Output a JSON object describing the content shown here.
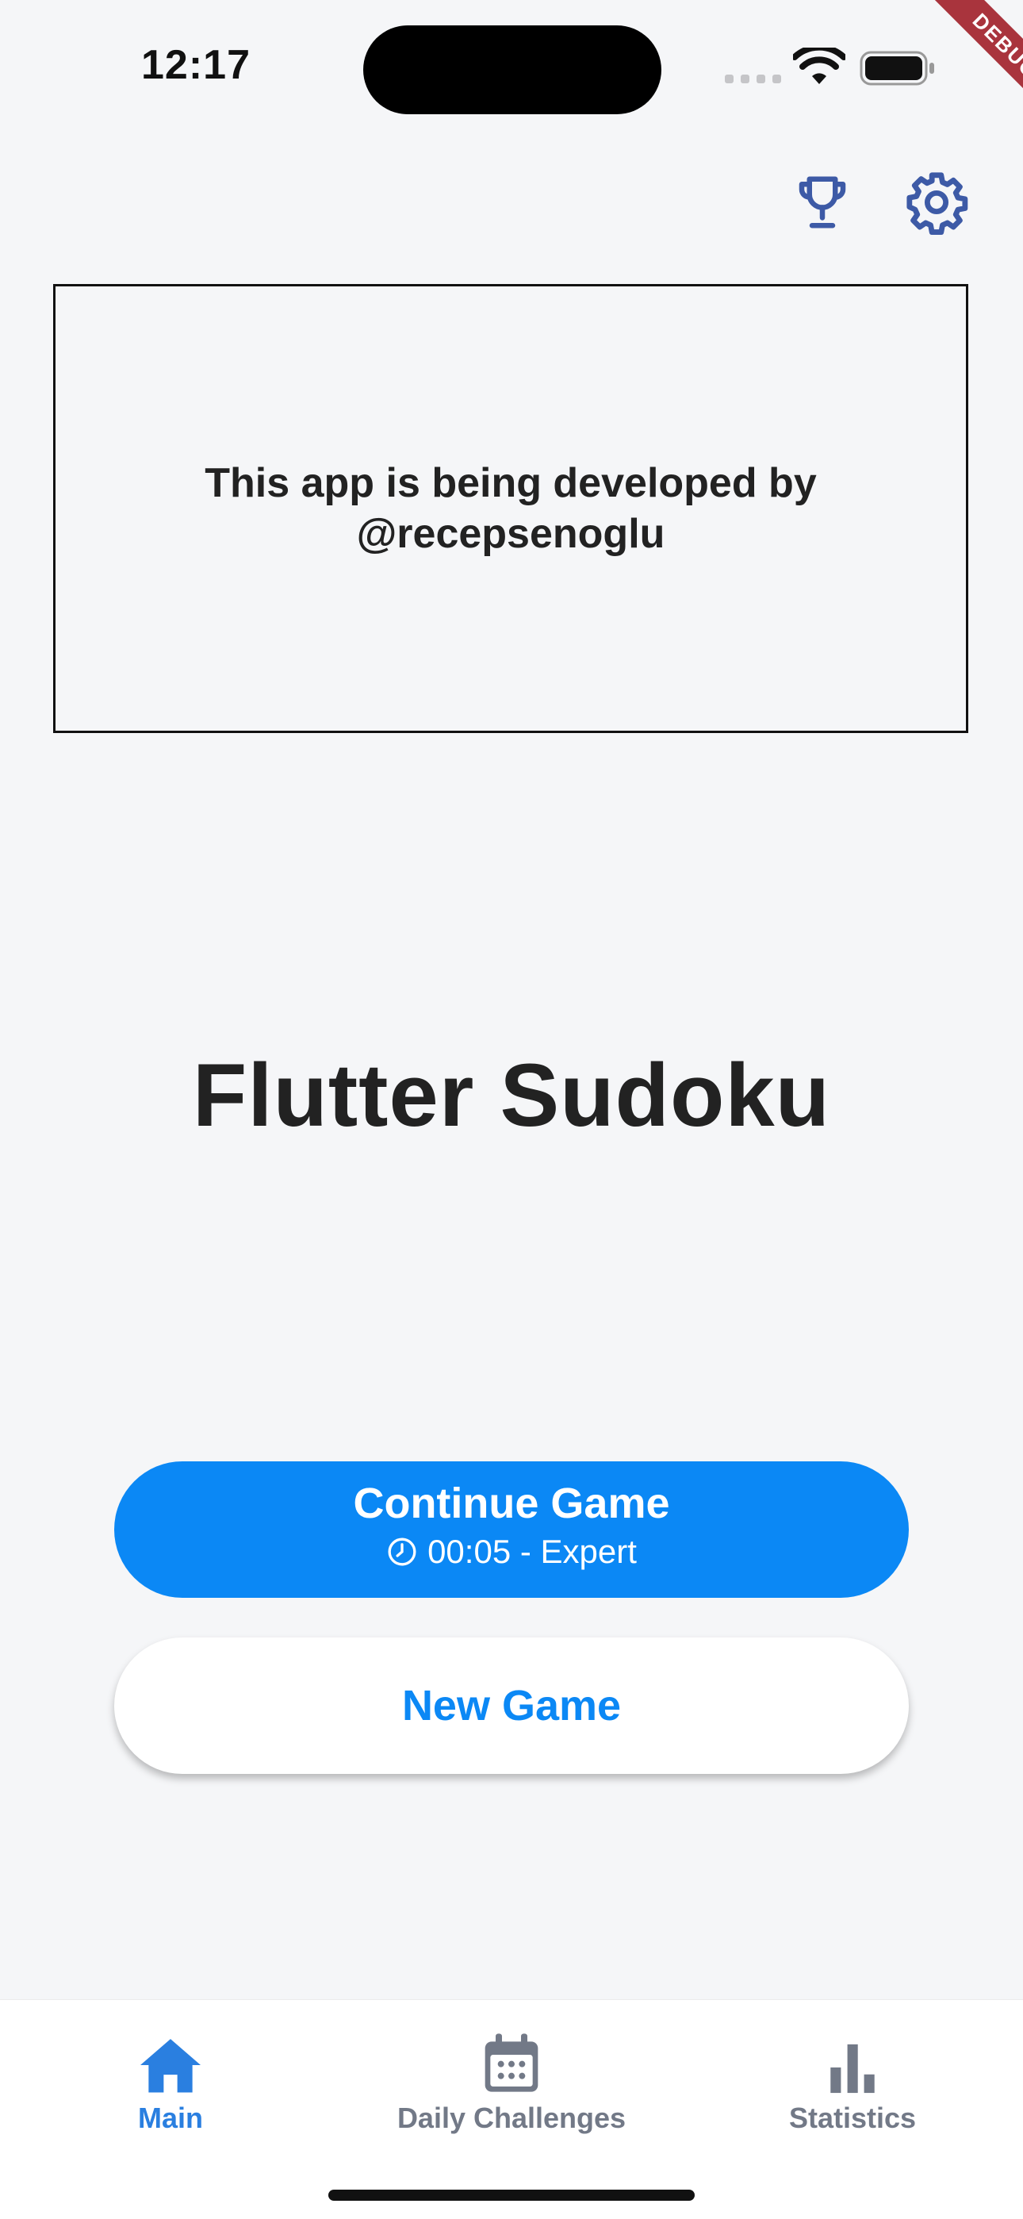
{
  "status_bar": {
    "time": "12:17"
  },
  "debug_label": "DEBUG",
  "header": {
    "icons": [
      "trophy-icon",
      "gear-icon"
    ]
  },
  "ad": {
    "text": "This app is being developed by\n@recepsenoglu"
  },
  "title": "Flutter Sudoku",
  "continue_button": {
    "label": "Continue Game",
    "time": "00:05",
    "separator": " - ",
    "difficulty": "Expert"
  },
  "new_game_button": {
    "label": "New Game"
  },
  "tabs": [
    {
      "label": "Main",
      "icon": "home-icon",
      "active": true
    },
    {
      "label": "Daily Challenges",
      "icon": "calendar-icon",
      "active": false
    },
    {
      "label": "Statistics",
      "icon": "bar-chart-icon",
      "active": false
    }
  ],
  "colors": {
    "accent": "#0b88f5",
    "icon_blue": "#3d5aa6",
    "inactive": "#727987",
    "background": "#f5f6f8"
  }
}
